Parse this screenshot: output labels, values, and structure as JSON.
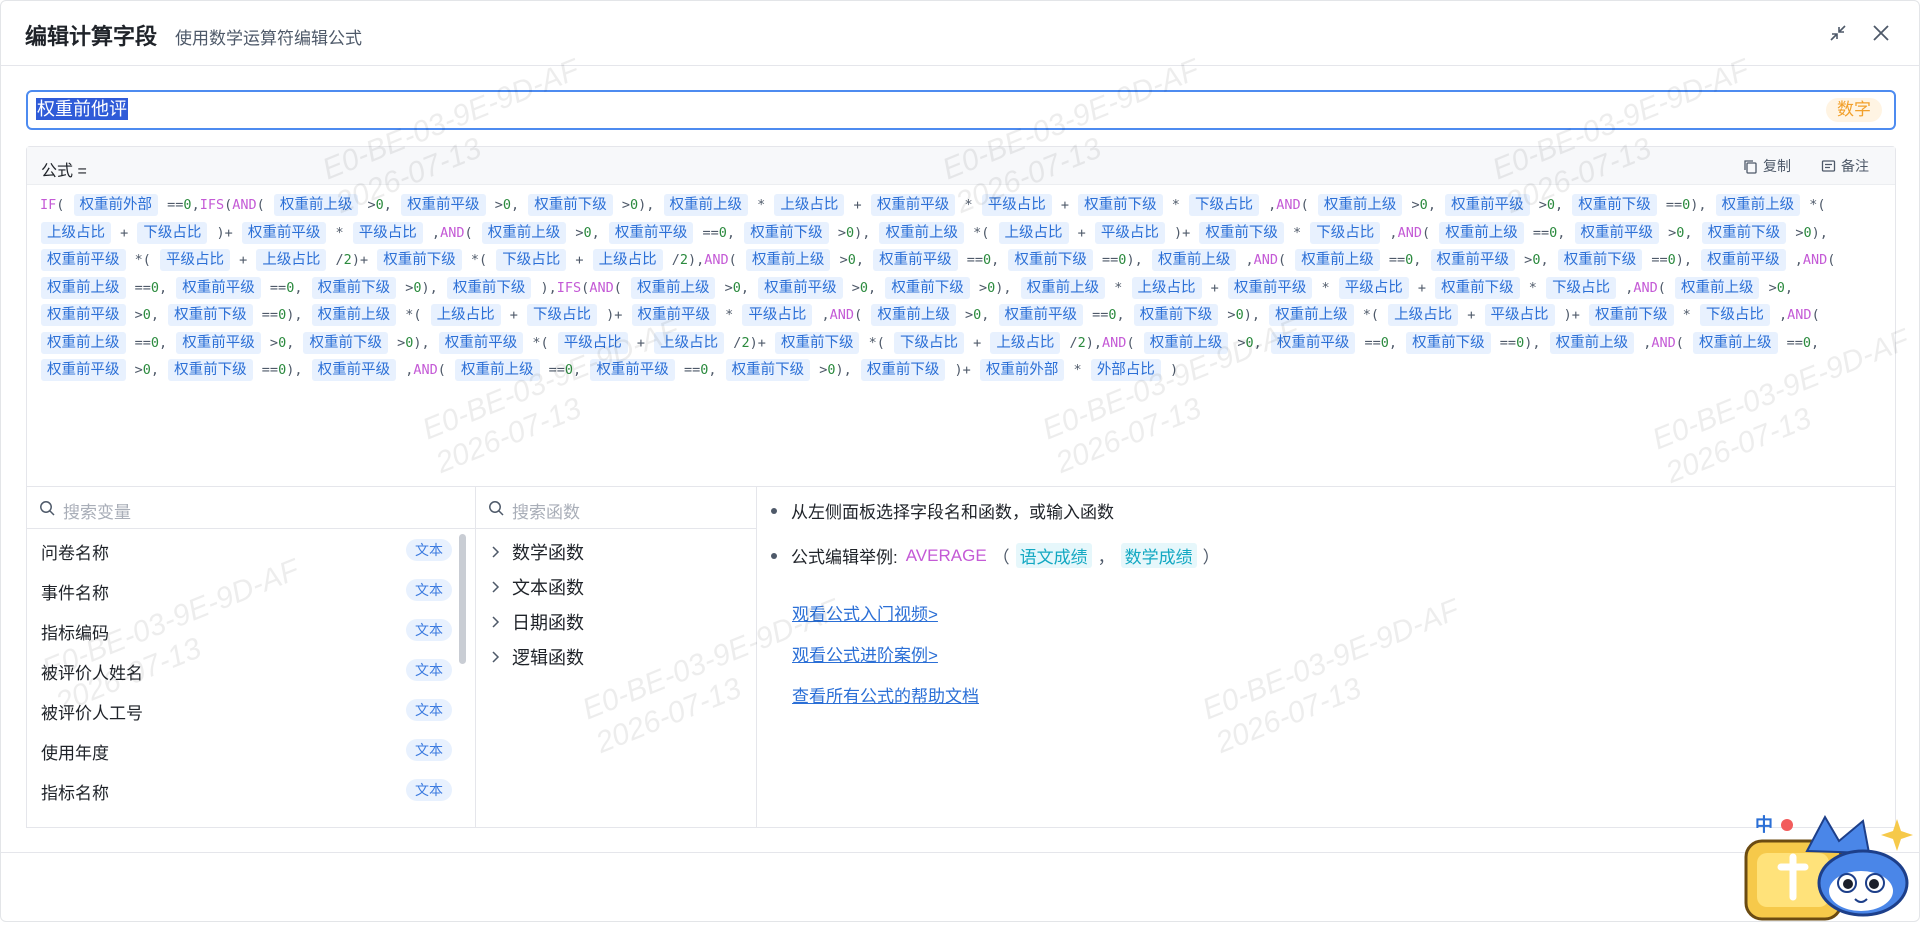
{
  "dialog": {
    "title": "编辑计算字段",
    "subtitle": "使用数学运算符编辑公式",
    "minimize_icon": "minimize-icon",
    "close_icon": "close-icon"
  },
  "field": {
    "name": "权重前他评",
    "type": "数字"
  },
  "formula": {
    "label": "公式 =",
    "copy_label": "复制",
    "note_label": "备注"
  },
  "variables": {
    "search_placeholder": "搜索变量",
    "items": [
      {
        "name": "问卷名称",
        "type": "文本"
      },
      {
        "name": "事件名称",
        "type": "文本"
      },
      {
        "name": "指标编码",
        "type": "文本"
      },
      {
        "name": "被评价人姓名",
        "type": "文本"
      },
      {
        "name": "被评价人工号",
        "type": "文本"
      },
      {
        "name": "使用年度",
        "type": "文本"
      },
      {
        "name": "指标名称",
        "type": "文本"
      }
    ]
  },
  "functions": {
    "search_placeholder": "搜索函数",
    "groups": [
      "数学函数",
      "文本函数",
      "日期函数",
      "逻辑函数"
    ]
  },
  "help": {
    "tip": "从左侧面板选择字段名和函数，或输入函数",
    "example_label": "公式编辑举例:",
    "example_fn": "AVERAGE",
    "example_open": "（",
    "example_arg1": "语文成绩",
    "example_sep": "，",
    "example_arg2": "数学成绩",
    "example_close": "）",
    "links": [
      "观看公式入门视频>",
      "观看公式进阶案例>",
      "查看所有公式的帮助文档"
    ]
  },
  "watermark": "E0-BE-03-9E-9D-AF\n2026-07-13",
  "colors": {
    "accent": "#4d8bf0",
    "field_chip_bg": "#e8f1fe",
    "function": "#c45ad6",
    "type_tag": "#f2a02b"
  }
}
